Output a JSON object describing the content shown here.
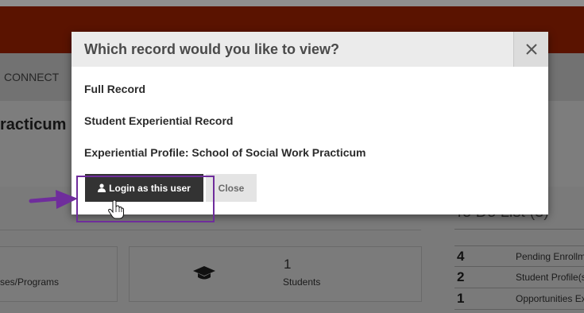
{
  "background": {
    "nav": {
      "connect": "CONNECT"
    },
    "page_title": "racticum",
    "cards": [
      {
        "label": "ses/Programs"
      },
      {
        "count": "1",
        "label": "Students",
        "icon": "graduation-cap-icon"
      }
    ],
    "todo": {
      "title": "To Do List (3)",
      "items": [
        {
          "count": "4",
          "label": "Pending Enrollm"
        },
        {
          "count": "2",
          "label": "Student Profile(s"
        },
        {
          "count": "1",
          "label": "Opportunities Ex"
        }
      ]
    }
  },
  "modal": {
    "title": "Which record would you like to view?",
    "close_icon": "close-icon",
    "records": [
      "Full Record",
      "Student Experiential Record",
      "Experiential Profile: School of Social Work Practicum"
    ],
    "login_button": "Login as this user",
    "login_icon": "user-icon",
    "close_button": "Close"
  },
  "annotation": {
    "arrow_color": "#6f2d9c",
    "box_color": "#6f2d9c"
  }
}
